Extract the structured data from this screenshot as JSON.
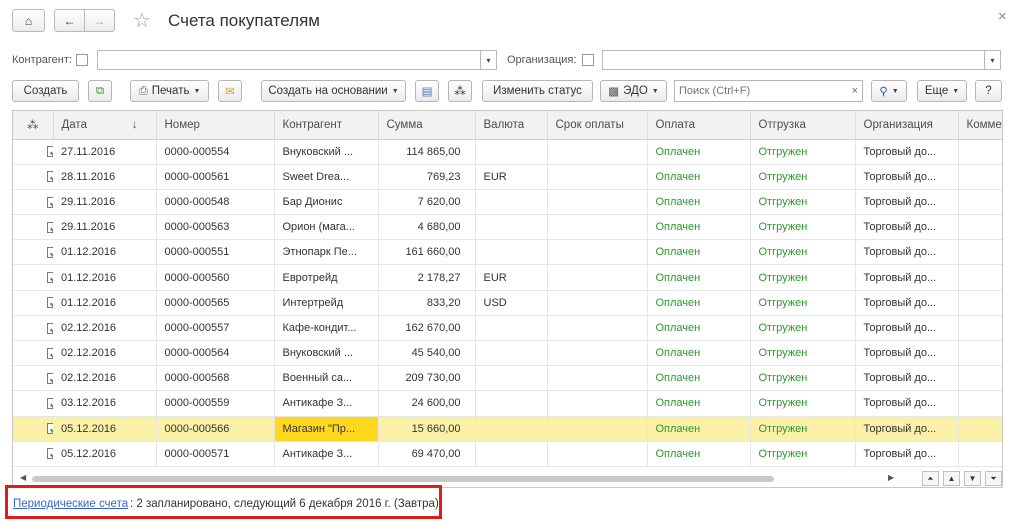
{
  "window": {
    "title": "Счета покупателям",
    "home_icon": "home-icon",
    "back_icon": "arrow-left-icon",
    "forward_icon": "arrow-right-icon",
    "favorite_icon": "star-icon",
    "close_icon": "close-icon"
  },
  "filters": {
    "kontragent_label": "Контрагент:",
    "kontragent_value": "",
    "organizacia_label": "Организация:",
    "organizacia_value": ""
  },
  "toolbar": {
    "create": "Создать",
    "print": "Печать",
    "create_based": "Создать на основании",
    "change_status": "Изменить статус",
    "edo": "ЭДО",
    "search_placeholder": "Поиск (Ctrl+F)",
    "more": "Еще",
    "help": "?"
  },
  "table": {
    "columns": [
      "Дата",
      "Номер",
      "Контрагент",
      "Сумма",
      "Валюта",
      "Срок оплаты",
      "Оплата",
      "Отгрузка",
      "Организация",
      "Комме"
    ],
    "sort_indicator": "↓",
    "rows": [
      {
        "date": "27.11.2016",
        "number": "0000-000554",
        "kontragent": "Внуковский ...",
        "sum": "114 865,00",
        "currency": "",
        "due": "",
        "payment": "Оплачен",
        "shipment": "Отгружен",
        "org": "Торговый до..."
      },
      {
        "date": "28.11.2016",
        "number": "0000-000561",
        "kontragent": "Sweet Drea...",
        "sum": "769,23",
        "currency": "EUR",
        "due": "",
        "payment": "Оплачен",
        "shipment": "Отгружен",
        "org": "Торговый до..."
      },
      {
        "date": "29.11.2016",
        "number": "0000-000548",
        "kontragent": "Бар Дионис",
        "sum": "7 620,00",
        "currency": "",
        "due": "",
        "payment": "Оплачен",
        "shipment": "Отгружен",
        "org": "Торговый до..."
      },
      {
        "date": "29.11.2016",
        "number": "0000-000563",
        "kontragent": "Орион (мага...",
        "sum": "4 680,00",
        "currency": "",
        "due": "",
        "payment": "Оплачен",
        "shipment": "Отгружен",
        "org": "Торговый до..."
      },
      {
        "date": "01.12.2016",
        "number": "0000-000551",
        "kontragent": "Этнопарк Пе...",
        "sum": "161 660,00",
        "currency": "",
        "due": "",
        "payment": "Оплачен",
        "shipment": "Отгружен",
        "org": "Торговый до..."
      },
      {
        "date": "01.12.2016",
        "number": "0000-000560",
        "kontragent": "Евротрейд",
        "sum": "2 178,27",
        "currency": "EUR",
        "due": "",
        "payment": "Оплачен",
        "shipment": "Отгружен",
        "org": "Торговый до..."
      },
      {
        "date": "01.12.2016",
        "number": "0000-000565",
        "kontragent": "Интертрейд",
        "sum": "833,20",
        "currency": "USD",
        "due": "",
        "payment": "Оплачен",
        "shipment": "Отгружен",
        "org": "Торговый до..."
      },
      {
        "date": "02.12.2016",
        "number": "0000-000557",
        "kontragent": "Кафе-кондит...",
        "sum": "162 670,00",
        "currency": "",
        "due": "",
        "payment": "Оплачен",
        "shipment": "Отгружен",
        "org": "Торговый до..."
      },
      {
        "date": "02.12.2016",
        "number": "0000-000564",
        "kontragent": "Внуковский ...",
        "sum": "45 540,00",
        "currency": "",
        "due": "",
        "payment": "Оплачен",
        "shipment": "Отгружен",
        "org": "Торговый до..."
      },
      {
        "date": "02.12.2016",
        "number": "0000-000568",
        "kontragent": "Военный са...",
        "sum": "209 730,00",
        "currency": "",
        "due": "",
        "payment": "Оплачен",
        "shipment": "Отгружен",
        "org": "Торговый до..."
      },
      {
        "date": "03.12.2016",
        "number": "0000-000559",
        "kontragent": "Антикафе З...",
        "sum": "24 600,00",
        "currency": "",
        "due": "",
        "payment": "Оплачен",
        "shipment": "Отгружен",
        "org": "Торговый до..."
      },
      {
        "date": "05.12.2016",
        "number": "0000-000566",
        "kontragent": "Магазин \"Пр...",
        "sum": "15 660,00",
        "currency": "",
        "due": "",
        "payment": "Оплачен",
        "shipment": "Отгружен",
        "org": "Торговый до...",
        "selected": true
      },
      {
        "date": "05.12.2016",
        "number": "0000-000571",
        "kontragent": "Антикафе З...",
        "sum": "69 470,00",
        "currency": "",
        "due": "",
        "payment": "Оплачен",
        "shipment": "Отгружен",
        "org": "Торговый до..."
      }
    ]
  },
  "footer": {
    "link": "Периодические счета",
    "text": ": 2 запланировано, следующий 6 декабря 2016 г. (Завтра)"
  },
  "colors": {
    "paid_green": "#2a9a2a",
    "selected_row": "#fbf0a7",
    "selected_cell": "#ffd81e",
    "highlight_border": "#e01b1b",
    "link": "#3366cc"
  }
}
